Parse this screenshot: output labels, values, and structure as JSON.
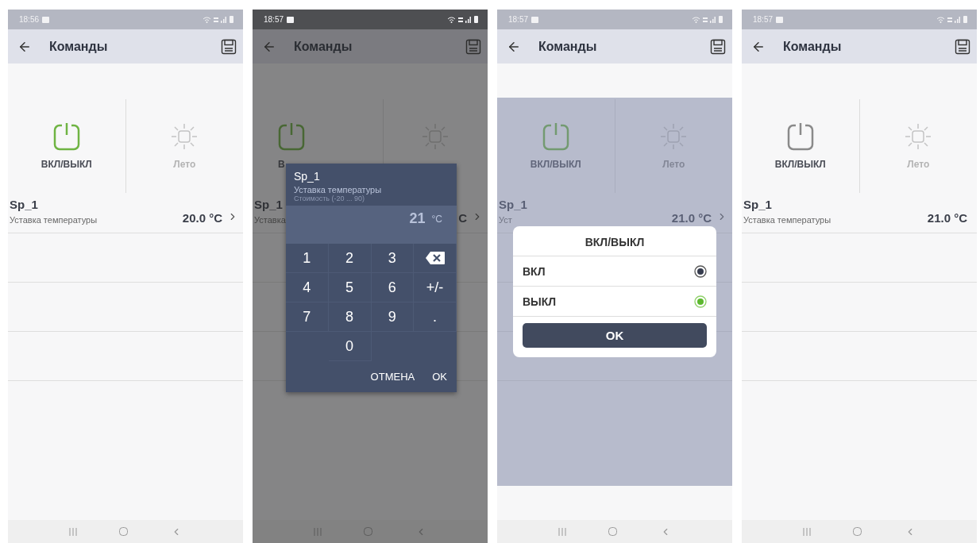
{
  "screens": [
    {
      "time": "18:56",
      "title": "Команды",
      "commands": [
        {
          "kind": "power",
          "label": "ВКЛ/ВЫКЛ",
          "on": true,
          "disabled": false
        },
        {
          "kind": "sun",
          "label": "Лето",
          "disabled": true
        }
      ],
      "items": [
        {
          "name": "Sp_1",
          "description": "Уставка температуры",
          "value": "20.0 °C",
          "chevron": true
        }
      ]
    },
    {
      "time": "18:57",
      "title": "Команды",
      "commands": [
        {
          "kind": "power",
          "label": "В",
          "on": true,
          "disabled": false
        },
        {
          "kind": "sun",
          "disabled": true
        }
      ],
      "items": [
        {
          "name": "Sp_1",
          "description": "Уставка",
          "value": "C",
          "chevron": true
        }
      ],
      "dialog": {
        "kind": "keypad",
        "title": "Sp_1",
        "subtitle": "Уставка температуры",
        "hint": "Стоимость (-20 ... 90)",
        "value": "21",
        "unit": "°C",
        "keys": [
          {
            "kind": "digit",
            "label": "1"
          },
          {
            "kind": "digit",
            "label": "2"
          },
          {
            "kind": "digit",
            "label": "3"
          },
          {
            "kind": "backspace"
          },
          {
            "kind": "digit",
            "label": "4"
          },
          {
            "kind": "digit",
            "label": "5"
          },
          {
            "kind": "digit",
            "label": "6"
          },
          {
            "kind": "digit",
            "label": "+/-"
          },
          {
            "kind": "digit",
            "label": "7"
          },
          {
            "kind": "digit",
            "label": "8"
          },
          {
            "kind": "digit",
            "label": "9"
          },
          {
            "kind": "digit",
            "label": "."
          },
          {
            "kind": "blank"
          },
          {
            "kind": "digit",
            "label": "0"
          },
          {
            "kind": "blank"
          },
          {
            "kind": "blank"
          }
        ],
        "buttons": [
          "ОТМЕНА",
          "OK"
        ]
      }
    },
    {
      "time": "18:57",
      "title": "Команды",
      "commands": [
        {
          "kind": "power",
          "label": "ВКЛ/ВЫКЛ",
          "on": true,
          "disabled": false
        },
        {
          "kind": "sun",
          "label": "Лето",
          "disabled": true
        }
      ],
      "items": [
        {
          "name": "Sp_1",
          "description": "Уст",
          "value": "21.0 °C",
          "chevron": true
        }
      ],
      "dialog": {
        "kind": "radio",
        "title": "ВКЛ/ВЫКЛ",
        "options": [
          {
            "label": "ВКЛ",
            "selected": false
          },
          {
            "label": "ВЫКЛ",
            "selected": true
          }
        ],
        "buttons": [
          "OK"
        ]
      }
    },
    {
      "time": "18:57",
      "title": "Команды",
      "commands": [
        {
          "kind": "power",
          "label": "ВКЛ/ВЫКЛ",
          "on": false,
          "disabled": false
        },
        {
          "kind": "sun",
          "label": "Лето",
          "disabled": true
        }
      ],
      "items": [
        {
          "name": "Sp_1",
          "description": "Уставка температуры",
          "value": "21.0 °C",
          "chevron": false
        }
      ]
    }
  ]
}
